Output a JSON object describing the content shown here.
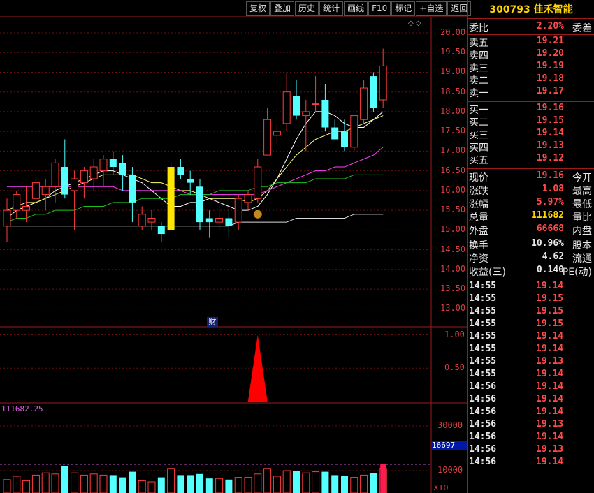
{
  "toolbar": {
    "buttons": [
      "复权",
      "叠加",
      "历史",
      "统计",
      "画线",
      "F10",
      "标记",
      "+自选",
      "返回"
    ]
  },
  "stock": {
    "code": "300793",
    "name": "佳禾智能",
    "title": "300793 佳禾智能"
  },
  "quote": {
    "weibi_label": "委比",
    "weibi_value": "2.20%",
    "weicha_label": "委差",
    "asks": [
      {
        "label": "卖五",
        "price": "19.21"
      },
      {
        "label": "卖四",
        "price": "19.20"
      },
      {
        "label": "卖三",
        "price": "19.19"
      },
      {
        "label": "卖二",
        "price": "19.18"
      },
      {
        "label": "卖一",
        "price": "19.17"
      }
    ],
    "bids": [
      {
        "label": "买一",
        "price": "19.16"
      },
      {
        "label": "买二",
        "price": "19.15"
      },
      {
        "label": "买三",
        "price": "19.14"
      },
      {
        "label": "买四",
        "price": "19.13"
      },
      {
        "label": "买五",
        "price": "19.12"
      }
    ],
    "stats": [
      {
        "label": "现价",
        "value": "19.16",
        "label2": "今开",
        "color": "#ff4b4b"
      },
      {
        "label": "涨跌",
        "value": "1.08",
        "label2": "最高",
        "color": "#ff4b4b"
      },
      {
        "label": "涨幅",
        "value": "5.97%",
        "label2": "最低",
        "color": "#ff4b4b"
      },
      {
        "label": "总量",
        "value": "111682",
        "label2": "量比",
        "color": "#ffd400"
      },
      {
        "label": "外盘",
        "value": "66668",
        "label2": "内盘",
        "color": "#ff4b4b"
      }
    ],
    "stats2": [
      {
        "label": "换手",
        "value": "10.96%",
        "label2": "股本",
        "color": "#e8e8e8"
      },
      {
        "label": "净资",
        "value": "4.62",
        "label2": "流通",
        "color": "#e8e8e8"
      },
      {
        "label": "收益(三)",
        "value": "0.140",
        "label2": "PE(动)",
        "color": "#e8e8e8"
      }
    ]
  },
  "ticks": [
    {
      "time": "14:55",
      "price": "19.14"
    },
    {
      "time": "14:55",
      "price": "19.15"
    },
    {
      "time": "14:55",
      "price": "19.15"
    },
    {
      "time": "14:55",
      "price": "19.15"
    },
    {
      "time": "14:55",
      "price": "19.14"
    },
    {
      "time": "14:55",
      "price": "19.14"
    },
    {
      "time": "14:55",
      "price": "19.13"
    },
    {
      "time": "14:55",
      "price": "19.14"
    },
    {
      "time": "14:56",
      "price": "19.14"
    },
    {
      "time": "14:56",
      "price": "19.14"
    },
    {
      "time": "14:56",
      "price": "19.14"
    },
    {
      "time": "14:56",
      "price": "19.13"
    },
    {
      "time": "14:56",
      "price": "19.14"
    },
    {
      "time": "14:56",
      "price": "19.13"
    },
    {
      "time": "14:56",
      "price": "19.14"
    }
  ],
  "chart_data": {
    "type": "candlestick",
    "price_axis": {
      "ticks": [
        "20.00",
        "19.50",
        "19.00",
        "18.50",
        "18.00",
        "17.50",
        "17.00",
        "16.50",
        "16.00",
        "15.50",
        "15.00",
        "14.50",
        "14.00",
        "13.50",
        "13.00"
      ],
      "range": [
        12.6,
        20.3
      ]
    },
    "candles": [
      {
        "o": 15.1,
        "h": 15.8,
        "l": 14.7,
        "c": 15.5
      },
      {
        "o": 15.5,
        "h": 16.0,
        "l": 15.3,
        "c": 15.9
      },
      {
        "o": 15.5,
        "h": 16.1,
        "l": 15.2,
        "c": 15.6
      },
      {
        "o": 15.8,
        "h": 16.3,
        "l": 15.6,
        "c": 16.2
      },
      {
        "o": 15.9,
        "h": 16.3,
        "l": 15.5,
        "c": 16.1
      },
      {
        "o": 16.1,
        "h": 16.8,
        "l": 15.7,
        "c": 16.7
      },
      {
        "o": 16.6,
        "h": 17.3,
        "l": 15.8,
        "c": 15.9
      },
      {
        "o": 16.0,
        "h": 16.5,
        "l": 15.0,
        "c": 16.3
      },
      {
        "o": 16.2,
        "h": 16.6,
        "l": 15.8,
        "c": 16.5
      },
      {
        "o": 16.3,
        "h": 16.8,
        "l": 16.0,
        "c": 16.6
      },
      {
        "o": 16.5,
        "h": 16.9,
        "l": 16.1,
        "c": 16.8
      },
      {
        "o": 16.8,
        "h": 17.0,
        "l": 16.4,
        "c": 16.6
      },
      {
        "o": 16.7,
        "h": 16.9,
        "l": 16.0,
        "c": 16.4
      },
      {
        "o": 16.4,
        "h": 16.6,
        "l": 15.2,
        "c": 15.7
      },
      {
        "o": 15.1,
        "h": 15.6,
        "l": 15.0,
        "c": 15.4
      },
      {
        "o": 15.2,
        "h": 15.5,
        "l": 15.0,
        "c": 15.3
      },
      {
        "o": 15.1,
        "h": 15.2,
        "l": 14.7,
        "c": 14.9
      },
      {
        "o": 15.0,
        "h": 16.7,
        "l": 15.0,
        "c": 16.6,
        "highlight": true
      },
      {
        "o": 16.6,
        "h": 16.8,
        "l": 16.3,
        "c": 16.4
      },
      {
        "o": 16.3,
        "h": 16.5,
        "l": 15.9,
        "c": 16.2
      },
      {
        "o": 16.1,
        "h": 16.3,
        "l": 15.0,
        "c": 15.2
      },
      {
        "o": 15.3,
        "h": 15.5,
        "l": 14.8,
        "c": 15.2
      },
      {
        "o": 15.2,
        "h": 15.6,
        "l": 15.0,
        "c": 15.3
      },
      {
        "o": 15.3,
        "h": 15.5,
        "l": 14.8,
        "c": 15.1
      },
      {
        "o": 15.2,
        "h": 15.9,
        "l": 15.0,
        "c": 15.8
      },
      {
        "o": 15.7,
        "h": 16.0,
        "l": 15.5,
        "c": 15.9
      },
      {
        "o": 15.8,
        "h": 16.8,
        "l": 15.7,
        "c": 16.6
      },
      {
        "o": 16.9,
        "h": 18.1,
        "l": 16.9,
        "c": 17.8
      },
      {
        "o": 17.4,
        "h": 17.7,
        "l": 17.2,
        "c": 17.5
      },
      {
        "o": 17.7,
        "h": 19.0,
        "l": 17.5,
        "c": 18.5
      },
      {
        "o": 18.4,
        "h": 18.8,
        "l": 17.8,
        "c": 17.9
      },
      {
        "o": 17.9,
        "h": 18.3,
        "l": 17.0,
        "c": 18.0
      },
      {
        "o": 18.2,
        "h": 18.9,
        "l": 18.0,
        "c": 18.2
      },
      {
        "o": 18.3,
        "h": 18.7,
        "l": 17.5,
        "c": 17.6
      },
      {
        "o": 17.6,
        "h": 17.8,
        "l": 17.3,
        "c": 17.3
      },
      {
        "o": 17.5,
        "h": 17.8,
        "l": 17.0,
        "c": 17.1
      },
      {
        "o": 17.1,
        "h": 17.9,
        "l": 17.0,
        "c": 17.9
      },
      {
        "o": 17.8,
        "h": 18.8,
        "l": 17.7,
        "c": 18.6
      },
      {
        "o": 18.9,
        "h": 19.0,
        "l": 18.0,
        "c": 18.1
      },
      {
        "o": 18.3,
        "h": 19.6,
        "l": 18.1,
        "c": 19.16
      }
    ],
    "ma_series": [
      {
        "color": "#ffffff",
        "values": [
          15.3,
          15.5,
          15.6,
          15.7,
          15.8,
          16.0,
          16.1,
          16.2,
          16.3,
          16.4,
          16.5,
          16.5,
          16.4,
          16.3,
          16.2,
          16.0,
          15.8,
          15.6,
          15.6,
          15.7,
          15.7,
          15.8,
          15.7,
          15.6,
          15.5,
          15.5,
          15.6,
          15.9,
          16.3,
          16.8,
          17.3,
          17.7,
          18.0,
          18.0,
          17.9,
          17.7,
          17.6,
          17.6,
          17.8,
          18.0
        ]
      },
      {
        "color": "#ffff70",
        "values": [
          15.5,
          15.6,
          15.7,
          15.7,
          15.8,
          15.9,
          16.0,
          16.1,
          16.2,
          16.3,
          16.4,
          16.4,
          16.4,
          16.4,
          16.3,
          16.2,
          16.2,
          16.1,
          16.0,
          16.0,
          15.9,
          15.8,
          15.8,
          15.8,
          15.8,
          15.7,
          15.8,
          16.0,
          16.3,
          16.6,
          16.9,
          17.1,
          17.3,
          17.4,
          17.5,
          17.5,
          17.6,
          17.7,
          17.8,
          17.9
        ]
      },
      {
        "color": "#ff40ff",
        "values": [
          16.1,
          16.1,
          16.1,
          16.1,
          16.1,
          16.1,
          16.1,
          16.1,
          16.1,
          16.1,
          16.1,
          16.1,
          16.0,
          16.0,
          16.0,
          16.0,
          16.0,
          16.0,
          16.0,
          15.9,
          15.9,
          15.9,
          15.9,
          15.9,
          15.9,
          15.9,
          15.9,
          16.0,
          16.1,
          16.2,
          16.3,
          16.4,
          16.5,
          16.5,
          16.6,
          16.6,
          16.7,
          16.8,
          16.9,
          17.1
        ]
      },
      {
        "color": "#20c020",
        "values": [
          15.2,
          15.3,
          15.3,
          15.4,
          15.4,
          15.5,
          15.5,
          15.5,
          15.6,
          15.6,
          15.6,
          15.7,
          15.7,
          15.7,
          15.8,
          15.8,
          15.8,
          15.8,
          15.9,
          15.9,
          15.9,
          15.9,
          16.0,
          16.0,
          16.0,
          16.0,
          16.1,
          16.1,
          16.2,
          16.2,
          16.2,
          16.2,
          16.3,
          16.3,
          16.3,
          16.3,
          16.4,
          16.4,
          16.4,
          16.4
        ]
      },
      {
        "color": "#d8d8d8",
        "values": [
          15.1,
          15.1,
          15.1,
          15.1,
          15.1,
          15.1,
          15.1,
          15.1,
          15.1,
          15.1,
          15.1,
          15.1,
          15.1,
          15.1,
          15.1,
          15.1,
          15.1,
          15.1,
          15.1,
          15.1,
          15.1,
          15.1,
          15.1,
          15.1,
          15.2,
          15.2,
          15.2,
          15.2,
          15.2,
          15.2,
          15.3,
          15.3,
          15.3,
          15.3,
          15.3,
          15.3,
          15.4,
          15.4,
          15.4,
          15.4
        ]
      }
    ],
    "indicator_axis": {
      "ticks": [
        "1.00",
        "0.50"
      ],
      "range": [
        0,
        1.1
      ]
    },
    "indicator_spike": {
      "index": 26,
      "value": 1.0
    },
    "volume_axis": {
      "ticks": [
        "30000",
        "10000"
      ],
      "range": [
        0,
        40000
      ]
    },
    "volume_label": "111682.25",
    "volume_marker": "16697",
    "volume_unit": "X10",
    "finance_marker": "财",
    "volume_values": [
      6000,
      7500,
      5500,
      8000,
      9000,
      8500,
      12000,
      9000,
      8000,
      8500,
      8000,
      8000,
      7000,
      9500,
      5500,
      5000,
      7000,
      11000,
      8000,
      8000,
      8500,
      6500,
      6500,
      6000,
      7000,
      7000,
      8500,
      11000,
      7500,
      10000,
      10000,
      9000,
      9500,
      9500,
      8000,
      7500,
      7000,
      8000,
      9000,
      11000
    ]
  }
}
